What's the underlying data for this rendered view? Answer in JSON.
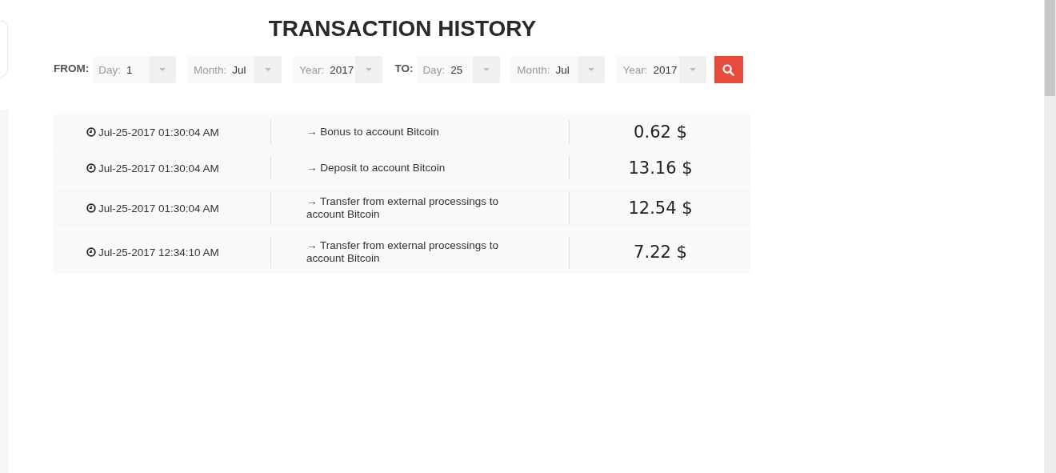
{
  "title": "TRANSACTION HISTORY",
  "filters": [
    {
      "kind": "label",
      "text": "FROM:"
    },
    {
      "kind": "select",
      "label": "Day:",
      "value": "1"
    },
    {
      "kind": "select",
      "label": "Month:",
      "value": "Jul"
    },
    {
      "kind": "select",
      "label": "Year:",
      "value": "2017"
    },
    {
      "kind": "label",
      "text": "TO:"
    },
    {
      "kind": "select",
      "label": "Day:",
      "value": "25"
    },
    {
      "kind": "select",
      "label": "Month:",
      "value": "Jul"
    },
    {
      "kind": "select",
      "label": "Year:",
      "value": "2017"
    }
  ],
  "transactions": [
    {
      "time": "Jul-25-2017 01:30:04 AM",
      "description": "→ Bonus to account Bitcoin",
      "amount": "0.62 $"
    },
    {
      "time": "Jul-25-2017 01:30:04 AM",
      "description": "→ Deposit to account Bitcoin",
      "amount": "13.16 $"
    },
    {
      "time": "Jul-25-2017 01:30:04 AM",
      "description": "→ Transfer from external processings to account Bitcoin",
      "amount": "12.54 $"
    },
    {
      "time": "Jul-25-2017 12:34:10 AM",
      "description": "→ Transfer from external processings to account Bitcoin",
      "amount": "7.22 $"
    }
  ]
}
